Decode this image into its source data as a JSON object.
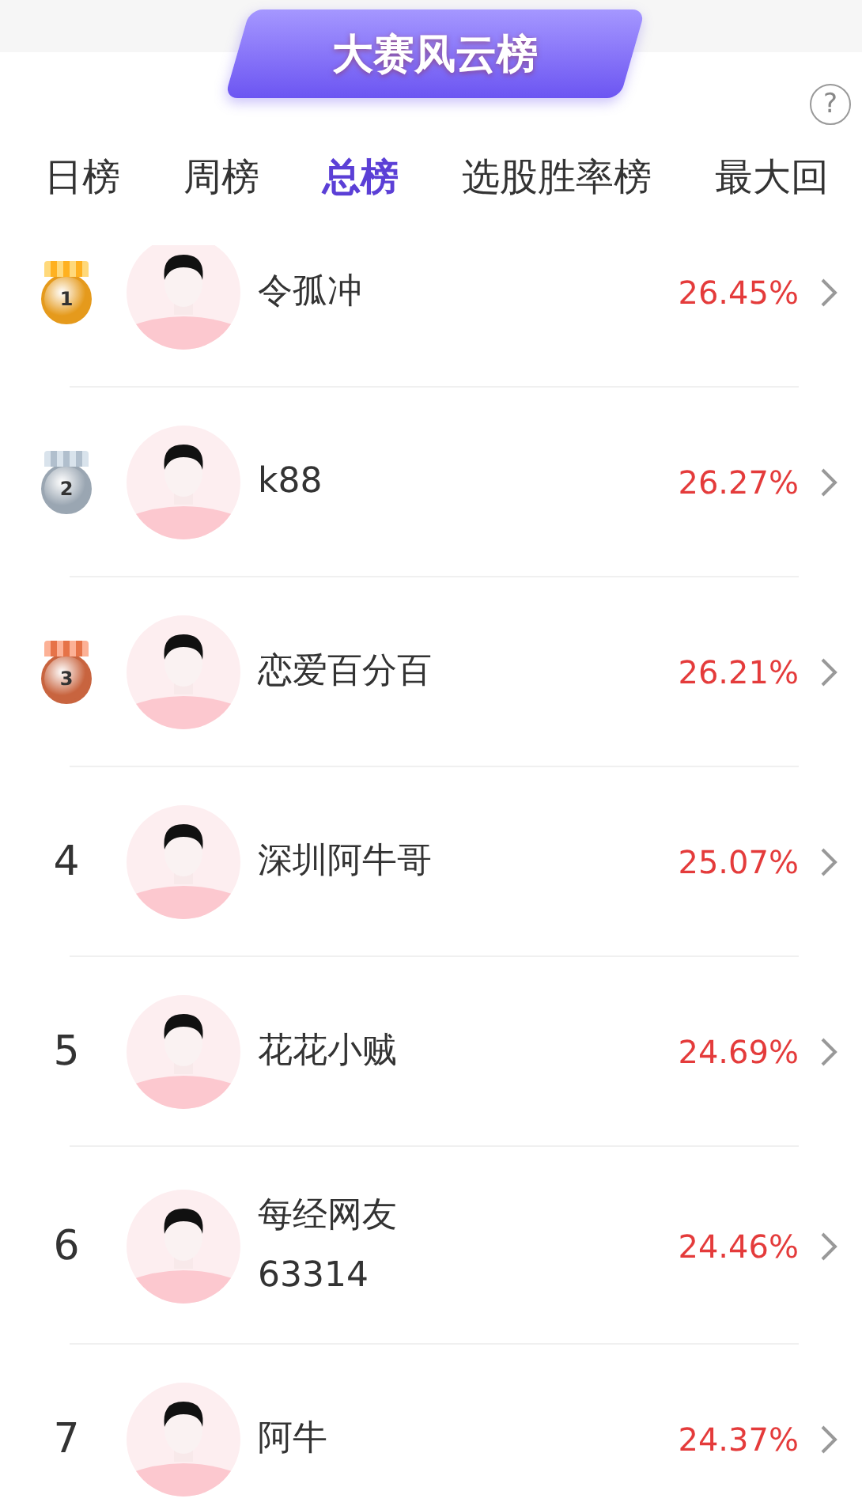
{
  "banner": {
    "title": "大赛风云榜"
  },
  "help": {
    "glyph": "?"
  },
  "tabs": [
    {
      "label": "日榜",
      "selected": false
    },
    {
      "label": "周榜",
      "selected": false
    },
    {
      "label": "总榜",
      "selected": true
    },
    {
      "label": "选股胜率榜",
      "selected": false
    },
    {
      "label": "最大回",
      "selected": false
    }
  ],
  "ranking": [
    {
      "kind": "medal",
      "rank": "1",
      "color": "#e59a1c",
      "name": "令孤冲",
      "return": "26.45%"
    },
    {
      "kind": "medal",
      "rank": "2",
      "color": "#9aa6b2",
      "name": "k88",
      "return": "26.27%"
    },
    {
      "kind": "medal",
      "rank": "3",
      "color": "#c8643f",
      "name": "恋爱百分百",
      "return": "26.21%"
    },
    {
      "kind": "number",
      "rank": "4",
      "name": "深圳阿牛哥",
      "return": "25.07%"
    },
    {
      "kind": "number",
      "rank": "5",
      "name": "花花小贼",
      "return": "24.69%"
    },
    {
      "kind": "number",
      "rank": "6",
      "name": "每经网友63314",
      "return": "24.46%"
    },
    {
      "kind": "number",
      "rank": "7",
      "name": "阿牛",
      "return": "24.37%"
    }
  ]
}
